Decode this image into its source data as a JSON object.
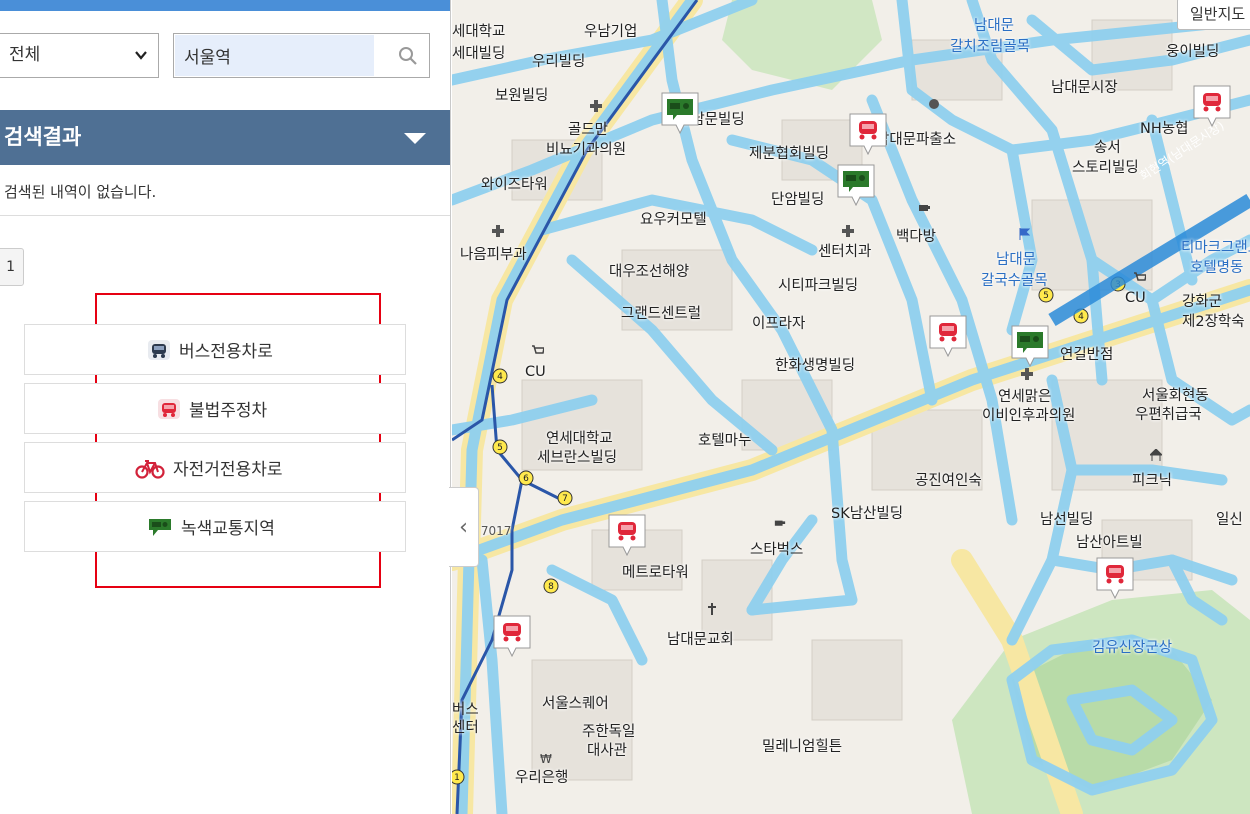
{
  "search": {
    "category_value": "전체",
    "query_value": "서울역"
  },
  "results": {
    "header": "검색결과",
    "empty_message": "검색된 내역이 없습니다.",
    "current_page": "1"
  },
  "legend": [
    {
      "label": "버스전용차로",
      "icon": "bus-icon",
      "color": "#2d3a4e"
    },
    {
      "label": "불법주정차",
      "icon": "illegal-parking-icon",
      "color": "#e0273a"
    },
    {
      "label": "자전거전용차로",
      "icon": "bicycle-icon",
      "color": "#d2223a"
    },
    {
      "label": "녹색교통지역",
      "icon": "green-traffic-icon",
      "color": "#2b7a2b"
    }
  ],
  "map": {
    "map_type_button": "일반지도",
    "labels": [
      "세대학교",
      "세대빌딩",
      "우남기업",
      "우리빌딩",
      "보원빌딩",
      "골드만",
      "비뇨기과의원",
      "신남문빌딩",
      "제분협회빌딩",
      "남대문파출소",
      "단암빌딩",
      "와이즈타워",
      "요우커모텔",
      "센터치과",
      "백다방",
      "나음피부과",
      "대우조선해양",
      "시티파크빌딩",
      "그랜드센트럴",
      "이프라자",
      "한화생명빌딩",
      "CU",
      "연세대학교",
      "세브란스빌딩",
      "호텔마누",
      "SK남산빌딩",
      "공진여인숙",
      "스타벅스",
      "메트로타워",
      "남대문교회",
      "서울스퀘어",
      "주한독일",
      "대사관",
      "우리은행",
      "밀레니엄힐튼",
      "버스",
      "센터",
      "남대문",
      "갈치조림골목",
      "웅이빌딩",
      "남대문시장",
      "NH농협",
      "송서",
      "스토리빌딩",
      "티마크그랜드",
      "호텔명동",
      "남대문",
      "갈국수골목",
      "CU",
      "강화군",
      "제2장학숙",
      "연길반점",
      "연세맑은",
      "이비인후과의원",
      "서울회현동",
      "우편취급국",
      "피크닉",
      "남선빌딩",
      "남산아트빌",
      "일신",
      "김유신장군상",
      "회현역(남대문시장)",
      "로 7017"
    ]
  }
}
